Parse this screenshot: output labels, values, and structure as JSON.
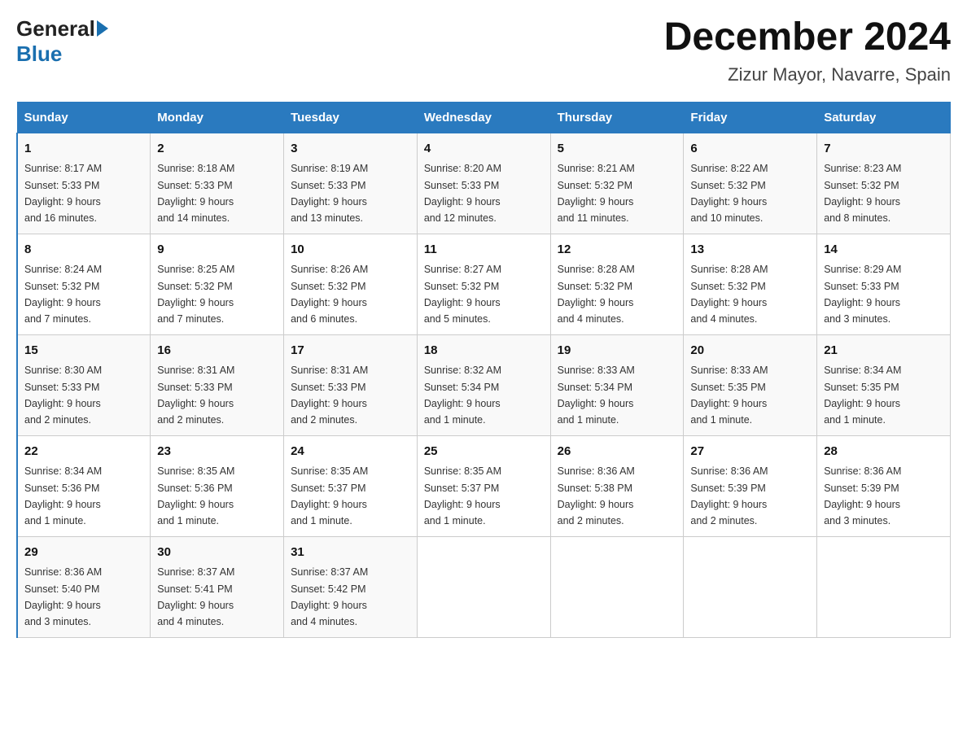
{
  "logo": {
    "general": "General",
    "blue": "Blue"
  },
  "title": "December 2024",
  "location": "Zizur Mayor, Navarre, Spain",
  "days_header": [
    "Sunday",
    "Monday",
    "Tuesday",
    "Wednesday",
    "Thursday",
    "Friday",
    "Saturday"
  ],
  "weeks": [
    [
      {
        "day": "1",
        "sunrise": "8:17 AM",
        "sunset": "5:33 PM",
        "daylight": "9 hours and 16 minutes."
      },
      {
        "day": "2",
        "sunrise": "8:18 AM",
        "sunset": "5:33 PM",
        "daylight": "9 hours and 14 minutes."
      },
      {
        "day": "3",
        "sunrise": "8:19 AM",
        "sunset": "5:33 PM",
        "daylight": "9 hours and 13 minutes."
      },
      {
        "day": "4",
        "sunrise": "8:20 AM",
        "sunset": "5:33 PM",
        "daylight": "9 hours and 12 minutes."
      },
      {
        "day": "5",
        "sunrise": "8:21 AM",
        "sunset": "5:32 PM",
        "daylight": "9 hours and 11 minutes."
      },
      {
        "day": "6",
        "sunrise": "8:22 AM",
        "sunset": "5:32 PM",
        "daylight": "9 hours and 10 minutes."
      },
      {
        "day": "7",
        "sunrise": "8:23 AM",
        "sunset": "5:32 PM",
        "daylight": "9 hours and 8 minutes."
      }
    ],
    [
      {
        "day": "8",
        "sunrise": "8:24 AM",
        "sunset": "5:32 PM",
        "daylight": "9 hours and 7 minutes."
      },
      {
        "day": "9",
        "sunrise": "8:25 AM",
        "sunset": "5:32 PM",
        "daylight": "9 hours and 7 minutes."
      },
      {
        "day": "10",
        "sunrise": "8:26 AM",
        "sunset": "5:32 PM",
        "daylight": "9 hours and 6 minutes."
      },
      {
        "day": "11",
        "sunrise": "8:27 AM",
        "sunset": "5:32 PM",
        "daylight": "9 hours and 5 minutes."
      },
      {
        "day": "12",
        "sunrise": "8:28 AM",
        "sunset": "5:32 PM",
        "daylight": "9 hours and 4 minutes."
      },
      {
        "day": "13",
        "sunrise": "8:28 AM",
        "sunset": "5:32 PM",
        "daylight": "9 hours and 4 minutes."
      },
      {
        "day": "14",
        "sunrise": "8:29 AM",
        "sunset": "5:33 PM",
        "daylight": "9 hours and 3 minutes."
      }
    ],
    [
      {
        "day": "15",
        "sunrise": "8:30 AM",
        "sunset": "5:33 PM",
        "daylight": "9 hours and 2 minutes."
      },
      {
        "day": "16",
        "sunrise": "8:31 AM",
        "sunset": "5:33 PM",
        "daylight": "9 hours and 2 minutes."
      },
      {
        "day": "17",
        "sunrise": "8:31 AM",
        "sunset": "5:33 PM",
        "daylight": "9 hours and 2 minutes."
      },
      {
        "day": "18",
        "sunrise": "8:32 AM",
        "sunset": "5:34 PM",
        "daylight": "9 hours and 1 minute."
      },
      {
        "day": "19",
        "sunrise": "8:33 AM",
        "sunset": "5:34 PM",
        "daylight": "9 hours and 1 minute."
      },
      {
        "day": "20",
        "sunrise": "8:33 AM",
        "sunset": "5:35 PM",
        "daylight": "9 hours and 1 minute."
      },
      {
        "day": "21",
        "sunrise": "8:34 AM",
        "sunset": "5:35 PM",
        "daylight": "9 hours and 1 minute."
      }
    ],
    [
      {
        "day": "22",
        "sunrise": "8:34 AM",
        "sunset": "5:36 PM",
        "daylight": "9 hours and 1 minute."
      },
      {
        "day": "23",
        "sunrise": "8:35 AM",
        "sunset": "5:36 PM",
        "daylight": "9 hours and 1 minute."
      },
      {
        "day": "24",
        "sunrise": "8:35 AM",
        "sunset": "5:37 PM",
        "daylight": "9 hours and 1 minute."
      },
      {
        "day": "25",
        "sunrise": "8:35 AM",
        "sunset": "5:37 PM",
        "daylight": "9 hours and 1 minute."
      },
      {
        "day": "26",
        "sunrise": "8:36 AM",
        "sunset": "5:38 PM",
        "daylight": "9 hours and 2 minutes."
      },
      {
        "day": "27",
        "sunrise": "8:36 AM",
        "sunset": "5:39 PM",
        "daylight": "9 hours and 2 minutes."
      },
      {
        "day": "28",
        "sunrise": "8:36 AM",
        "sunset": "5:39 PM",
        "daylight": "9 hours and 3 minutes."
      }
    ],
    [
      {
        "day": "29",
        "sunrise": "8:36 AM",
        "sunset": "5:40 PM",
        "daylight": "9 hours and 3 minutes."
      },
      {
        "day": "30",
        "sunrise": "8:37 AM",
        "sunset": "5:41 PM",
        "daylight": "9 hours and 4 minutes."
      },
      {
        "day": "31",
        "sunrise": "8:37 AM",
        "sunset": "5:42 PM",
        "daylight": "9 hours and 4 minutes."
      },
      null,
      null,
      null,
      null
    ]
  ],
  "labels": {
    "sunrise": "Sunrise:",
    "sunset": "Sunset:",
    "daylight": "Daylight:"
  }
}
